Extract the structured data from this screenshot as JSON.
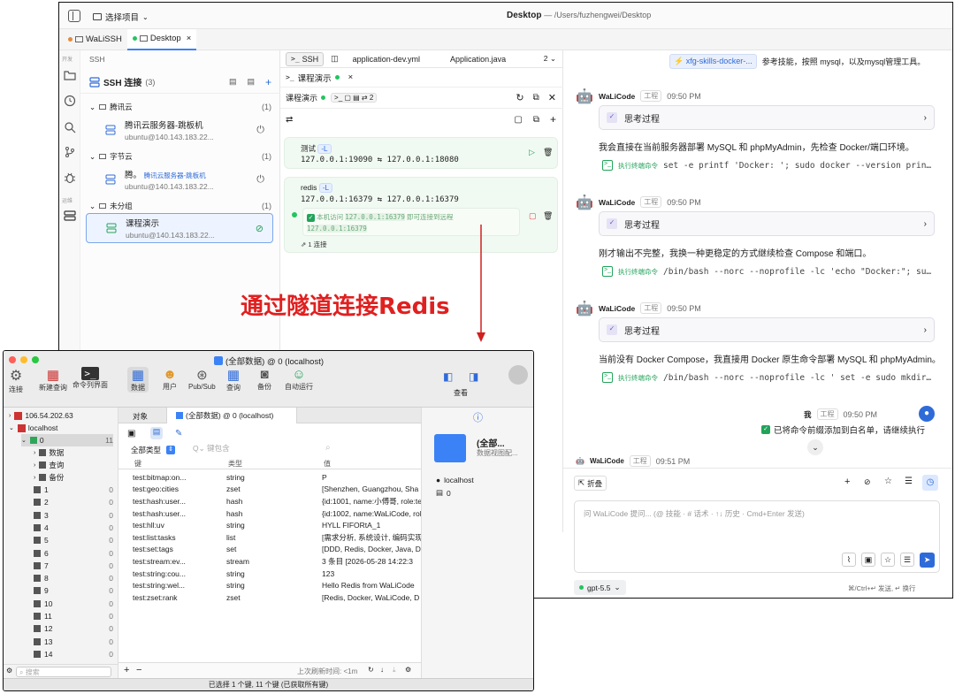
{
  "main": {
    "title": "Desktop",
    "path": "— /Users/fuzhengwei/Desktop",
    "project_select": "选择项目",
    "tabs": [
      "WaLiSSH",
      "Desktop"
    ],
    "activity": {
      "top_label": "开发",
      "bottom_label": "运维"
    },
    "ssh": {
      "header": "SSH",
      "title": "SSH 连接",
      "count": "(3)",
      "groups": [
        {
          "name": "腾讯云",
          "count": "(1)",
          "hosts": [
            {
              "name": "腾讯云服务器-跳板机",
              "addr": "ubuntu@140.143.183.22..."
            }
          ]
        },
        {
          "name": "字节云",
          "count": "(1)",
          "hosts": [
            {
              "name": "腾。",
              "badge": "腾讯云服务器-跳板机",
              "addr": "ubuntu@140.143.183.22..."
            }
          ]
        },
        {
          "name": "未分组",
          "count": "(1)",
          "hosts": [
            {
              "name": "课程演示",
              "addr": "ubuntu@140.143.183.22..."
            }
          ]
        }
      ]
    },
    "mid": {
      "tabs": [
        "SSH",
        "application-dev.yml",
        "Application.java"
      ],
      "tab_more": "2",
      "session_tab": "课程演示",
      "session_label": "课程演示",
      "tunnel_count": "2",
      "tunnels": [
        {
          "name": "测试",
          "mode": "-L",
          "route": "127.0.0.1:19090 ⇆ 127.0.0.1:18080"
        },
        {
          "name": "redis",
          "mode": "-L",
          "route": "127.0.0.1:16379 ⇆ 127.0.0.1:16379",
          "status_prefix": "本机访问",
          "status_addr": "127.0.0.1:16379",
          "status_suffix": "即可连接到远程",
          "status_addr2": "127.0.0.1:16379",
          "conn": "1 连接"
        }
      ]
    },
    "chat": {
      "top_chip": "xfg-skills-docker-...",
      "top_text": "参考技能，按照 mysql，以及mysql管理工具。",
      "messages": [
        {
          "name": "WaLiCode",
          "tag": "工程",
          "time": "09:50 PM",
          "think": "思考过程",
          "text": "我会直接在当前服务器部署 MySQL 和 phpMyAdmin，先检查 Docker/端口环境。",
          "cmd_label": "执行终端命令",
          "cmd": "set -e printf 'Docker: '; sudo docker --version prin…"
        },
        {
          "name": "WaLiCode",
          "tag": "工程",
          "time": "09:50 PM",
          "think": "思考过程",
          "text": "刚才输出不完整，我换一种更稳定的方式继续检查 Compose 和端口。",
          "cmd_label": "执行终端命令",
          "cmd": "/bin/bash --norc --noprofile -lc 'echo \"Docker:\"; su…"
        },
        {
          "name": "WaLiCode",
          "tag": "工程",
          "time": "09:50 PM",
          "think": "思考过程",
          "text": "当前没有 Docker Compose，我直接用 Docker 原生命令部署 MySQL 和 phpMyAdmin。",
          "cmd_label": "执行终端命令",
          "cmd": "/bin/bash --norc --noprofile -lc ' set -e sudo mkdir…"
        }
      ],
      "user": {
        "name": "我",
        "tag": "工程",
        "time": "09:50 PM",
        "text": "已将命令前缀添加到白名单，请继续执行"
      },
      "next": {
        "name": "WaLiCode",
        "tag": "工程",
        "time": "09:51 PM"
      },
      "collapse": "折叠",
      "input_placeholder": "问 WaLiCode 提问... (@ 技能 · # 话术 · ↑↓ 历史 · Cmd+Enter 发送)",
      "model": "gpt-5.5",
      "hint": "⌘/Ctrl+↵ 发送, ↵ 换行"
    }
  },
  "annotation": "通过隧道连接Redis",
  "redis": {
    "title": "(全部数据) @ 0 (localhost)",
    "toolbar": [
      "连接",
      "新建查询",
      "命令列界面",
      "数据",
      "用户",
      "Pub/Sub",
      "查询",
      "备份",
      "自动运行"
    ],
    "toolbar_right": "查看",
    "tree": {
      "servers": [
        "106.54.202.63",
        "localhost"
      ],
      "db0": {
        "name": "0",
        "count": "11"
      },
      "children": [
        "数据",
        "查询",
        "备份"
      ],
      "dbs": [
        {
          "n": "1",
          "c": "0"
        },
        {
          "n": "2",
          "c": "0"
        },
        {
          "n": "3",
          "c": "0"
        },
        {
          "n": "4",
          "c": "0"
        },
        {
          "n": "5",
          "c": "0"
        },
        {
          "n": "6",
          "c": "0"
        },
        {
          "n": "7",
          "c": "0"
        },
        {
          "n": "8",
          "c": "0"
        },
        {
          "n": "9",
          "c": "0"
        },
        {
          "n": "10",
          "c": "0"
        },
        {
          "n": "11",
          "c": "0"
        },
        {
          "n": "12",
          "c": "0"
        },
        {
          "n": "13",
          "c": "0"
        },
        {
          "n": "14",
          "c": "0"
        }
      ]
    },
    "search_placeholder": "搜索",
    "obj_tab": "对象",
    "data_tab": "(全部数据) @ 0 (localhost)",
    "filter": "全部类型",
    "key_placeholder": "键包含",
    "cols": [
      "键",
      "类型",
      "值"
    ],
    "rows": [
      [
        "test:bitmap:on...",
        "string",
        "P"
      ],
      [
        "test:geo:cities",
        "zset",
        "[Shenzhen, Guangzhou, Sha"
      ],
      [
        "test:hash:user...",
        "hash",
        "{id:1001, name:小傅哥, role:te"
      ],
      [
        "test:hash:user...",
        "hash",
        "{id:1002, name:WaLiCode, role"
      ],
      [
        "test:hll:uv",
        "string",
        "HYLL        FIFORtA_1"
      ],
      [
        "test:list:tasks",
        "list",
        "[需求分析, 系统设计, 编码实现"
      ],
      [
        "test:set:tags",
        "set",
        "[DDD, Redis, Docker, Java, D"
      ],
      [
        "test:stream:ev...",
        "stream",
        "3 条目 [2026-05-28 14:22:3"
      ],
      [
        "test:string:cou...",
        "string",
        "123"
      ],
      [
        "test:string:wel...",
        "string",
        "Hello Redis from WaLiCode"
      ],
      [
        "test:zset:rank",
        "zset",
        "[Redis, Docker, WaLiCode, D"
      ]
    ],
    "info": {
      "title": "(全部...",
      "subtitle": "数据视图配...",
      "server": "localhost",
      "db": "0"
    },
    "refresh": "上次刷新时间: <1m",
    "status": "已选择 1 个键, 11 个键 (已获取所有键)"
  }
}
